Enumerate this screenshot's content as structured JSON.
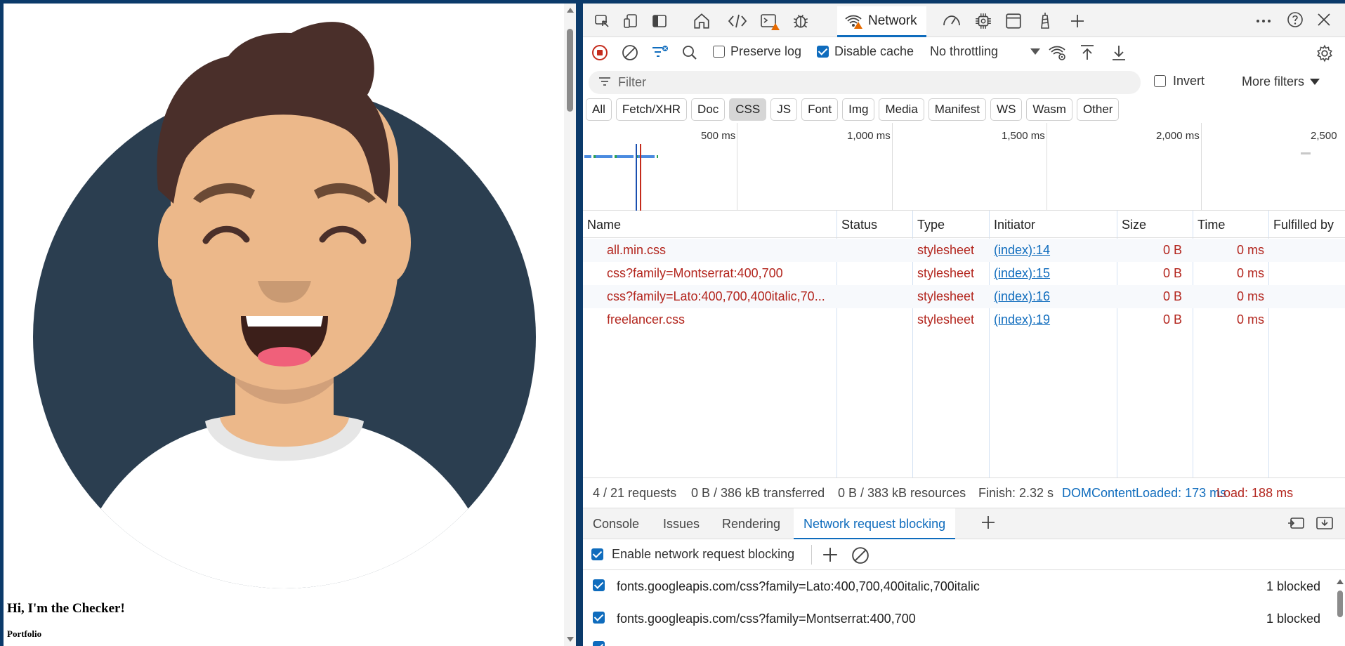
{
  "page": {
    "hero_title": "Hi, I'm the Checker!",
    "hero_subtitle": "Portfolio"
  },
  "devtools": {
    "main_tabs": {
      "network_label": "Network"
    },
    "toolbar": {
      "preserve_log_label": "Preserve log",
      "preserve_log_checked": false,
      "disable_cache_label": "Disable cache",
      "disable_cache_checked": true,
      "throttling_value": "No throttling"
    },
    "filter": {
      "placeholder": "Filter",
      "invert_label": "Invert",
      "more_filters_label": "More filters"
    },
    "type_chips": [
      "All",
      "Fetch/XHR",
      "Doc",
      "CSS",
      "JS",
      "Font",
      "Img",
      "Media",
      "Manifest",
      "WS",
      "Wasm",
      "Other"
    ],
    "selected_chip": "CSS",
    "overview_ticks": [
      "500 ms",
      "1,000 ms",
      "1,500 ms",
      "2,000 ms",
      "2,500"
    ],
    "columns": [
      "Name",
      "Status",
      "Type",
      "Initiator",
      "Size",
      "Time",
      "Fulfilled by"
    ],
    "requests": [
      {
        "name": "all.min.css",
        "status": "",
        "type": "stylesheet",
        "initiator": "(index):14",
        "size": "0 B",
        "time": "0 ms"
      },
      {
        "name": "css?family=Montserrat:400,700",
        "status": "",
        "type": "stylesheet",
        "initiator": "(index):15",
        "size": "0 B",
        "time": "0 ms"
      },
      {
        "name": "css?family=Lato:400,700,400italic,70...",
        "status": "",
        "type": "stylesheet",
        "initiator": "(index):16",
        "size": "0 B",
        "time": "0 ms"
      },
      {
        "name": "freelancer.css",
        "status": "",
        "type": "stylesheet",
        "initiator": "(index):19",
        "size": "0 B",
        "time": "0 ms"
      }
    ],
    "summary": {
      "requests": "4 / 21 requests",
      "transferred": "0 B / 386 kB transferred",
      "resources": "0 B / 383 kB resources",
      "finish": "Finish: 2.32 s",
      "dom_content_loaded": "DOMContentLoaded: 173 ms",
      "load": "Load: 188 ms"
    },
    "drawer_tabs": [
      "Console",
      "Issues",
      "Rendering",
      "Network request blocking"
    ],
    "active_drawer_tab": "Network request blocking",
    "blocking": {
      "enable_label": "Enable network request blocking",
      "enable_checked": true,
      "patterns": [
        {
          "url": "fonts.googleapis.com/css?family=Lato:400,700,400italic,700italic",
          "count": "1 blocked",
          "checked": true
        },
        {
          "url": "fonts.googleapis.com/css?family=Montserrat:400,700",
          "count": "1 blocked",
          "checked": true
        }
      ]
    },
    "colors": {
      "accent": "#0f6cbd",
      "error_red": "#b3261e",
      "avatar_bg": "#2b3e50",
      "skin": "#ecb88a",
      "hair": "#4a2f2a"
    }
  }
}
